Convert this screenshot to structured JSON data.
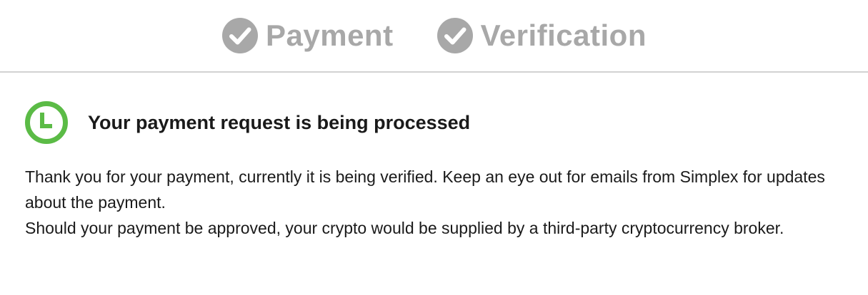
{
  "steps": [
    {
      "label": "Payment",
      "icon": "check-circle-icon",
      "state": "complete"
    },
    {
      "label": "Verification",
      "icon": "check-circle-icon",
      "state": "complete"
    }
  ],
  "status": {
    "icon": "clock-icon",
    "title": "Your payment request is being processed"
  },
  "message": {
    "line1": "Thank you for your payment, currently it is being verified. Keep an eye out for emails from Simplex for updates about the payment.",
    "line2": "Should your payment be approved, your crypto would be supplied by a third-party cryptocurrency broker."
  },
  "colors": {
    "step_gray": "#a8a8a8",
    "divider": "#d2d2d2",
    "status_green": "#5bbb46",
    "text": "#1a1a1a"
  }
}
